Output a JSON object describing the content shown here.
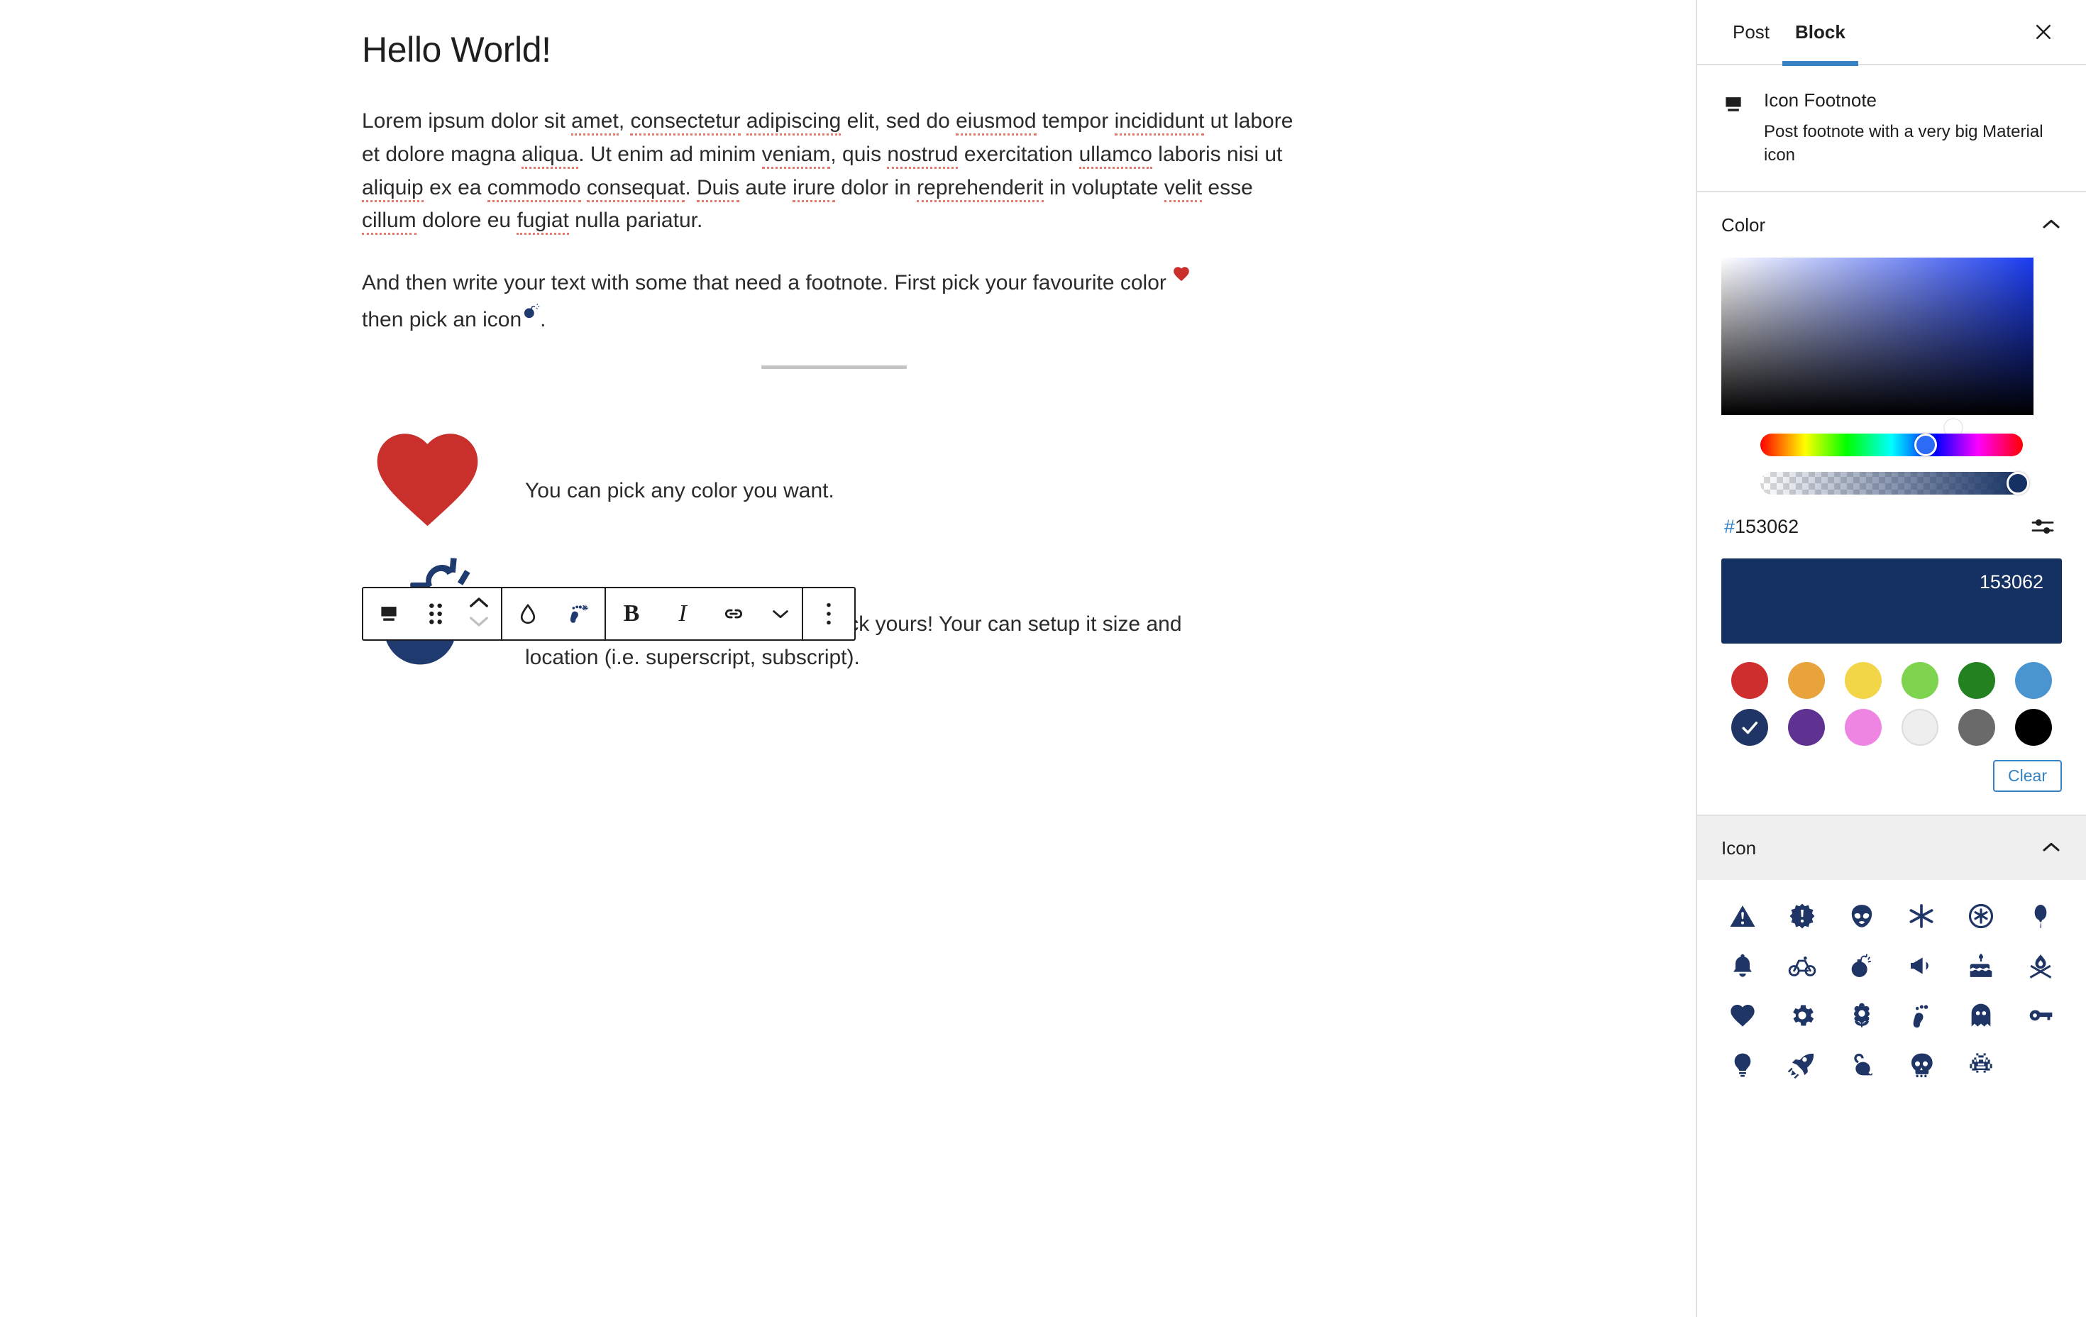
{
  "editor": {
    "post_title": "Hello World!",
    "paragraph_1": "Lorem ipsum dolor sit amet, consectetur adipiscing elit, sed do eiusmod tempor incididunt ut labore et dolore magna aliqua. Ut enim ad minim veniam, quis nostrud exercitation ullamco laboris nisi ut aliquip ex ea commodo consequat. Duis aute irure dolor in reprehenderit in voluptate velit esse cillum dolore eu fugiat nulla pariatur.",
    "paragraph_2_part_1": "And then write your text with some that need a footnote. First pick your favourite color",
    "paragraph_2_part_2": "then pick an icon",
    "paragraph_2_end": ".",
    "footnotes": [
      {
        "icon": "heart-icon",
        "icon_color": "#c9302c",
        "text": "You can pick any color you want."
      },
      {
        "icon": "bomb-icon",
        "icon_color": "#1e3a6e",
        "text": "There is a lot of icons available. Pick yours!  Your can setup it size and location (i.e. superscript, subscript)."
      }
    ]
  },
  "toolbar": {
    "block_type_icon": "footnote-block-icon",
    "drag_handle_icon": "drag-handle-icon",
    "move_up_icon": "chevron-up-icon",
    "move_down_icon": "chevron-down-icon",
    "color_icon": "droplet-icon",
    "icon_picker_icon": "footprint-sparkle-icon",
    "bold_label": "B",
    "italic_label": "I",
    "link_icon": "link-icon",
    "more_formats_icon": "chevron-down-icon",
    "options_icon": "vertical-dots-icon"
  },
  "sidebar": {
    "tabs": [
      {
        "label": "Post",
        "active": false
      },
      {
        "label": "Block",
        "active": true
      }
    ],
    "close_icon": "close-icon",
    "block_card": {
      "icon": "footnote-block-icon",
      "title": "Icon Footnote",
      "description": "Post footnote with a very big Material icon"
    },
    "color_panel": {
      "title": "Color",
      "toggle_icon": "chevron-up-icon",
      "picker_handle_icon": "color-picker-handle",
      "hue_slider_icon": "hue-slider",
      "alpha_slider_icon": "alpha-slider",
      "hex_hash": "#",
      "hex_value": "153062",
      "options_icon": "sliders-icon",
      "preview_color": "#153062",
      "preview_label": "153062",
      "swatches": [
        {
          "name": "red",
          "color": "#cf2e2e",
          "selected": false
        },
        {
          "name": "orange",
          "color": "#e8a33d",
          "selected": false
        },
        {
          "name": "yellow",
          "color": "#f2d648",
          "selected": false
        },
        {
          "name": "light-green",
          "color": "#7ed34f",
          "selected": false
        },
        {
          "name": "dark-green",
          "color": "#23811f",
          "selected": false
        },
        {
          "name": "light-blue",
          "color": "#4a94d0",
          "selected": false
        },
        {
          "name": "navy",
          "color": "#1f3566",
          "selected": true
        },
        {
          "name": "purple",
          "color": "#5f3191",
          "selected": false
        },
        {
          "name": "pink",
          "color": "#ef85e3",
          "selected": false
        },
        {
          "name": "white",
          "color": "#eeeeee",
          "selected": false
        },
        {
          "name": "gray",
          "color": "#6a6a6a",
          "selected": false
        },
        {
          "name": "black",
          "color": "#000000",
          "selected": false
        }
      ],
      "clear_label": "Clear"
    },
    "icon_panel": {
      "title": "Icon",
      "toggle_icon": "chevron-up-icon",
      "icon_color": "#1f3566",
      "icons": [
        "warning-triangle-icon",
        "burst-exclamation-icon",
        "alien-icon",
        "asterisk-icon",
        "asterisk-circle-icon",
        "balloon-icon",
        "bell-icon",
        "bicycle-icon",
        "bomb-icon",
        "megaphone-icon",
        "birthday-cake-icon",
        "campfire-icon",
        "heart-icon",
        "gear-icon",
        "flower-icon",
        "footprint-icon",
        "ghost-icon",
        "key-icon",
        "lightbulb-icon",
        "rocket-icon",
        "mouse-icon",
        "skull-icon",
        "space-invader-icon"
      ]
    }
  }
}
